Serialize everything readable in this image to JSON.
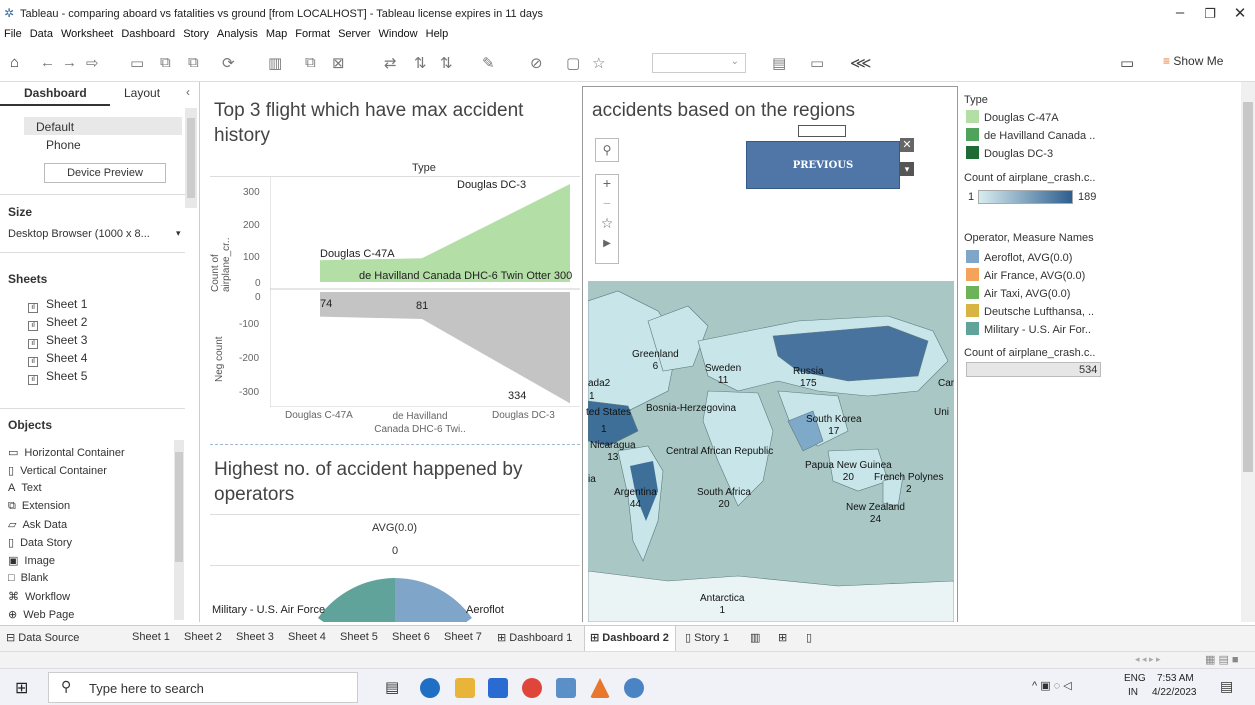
{
  "window": {
    "title": "Tableau - comparing aboard vs fatalities vs ground [from LOCALHOST] - Tableau license expires in 11 days"
  },
  "menu": [
    "File",
    "Data",
    "Worksheet",
    "Dashboard",
    "Story",
    "Analysis",
    "Map",
    "Format",
    "Server",
    "Window",
    "Help"
  ],
  "toolbar": {
    "show_me": "Show Me"
  },
  "left": {
    "tab_dashboard": "Dashboard",
    "tab_layout": "Layout",
    "device_default": "Default",
    "device_phone": "Phone",
    "device_preview": "Device Preview",
    "size_header": "Size",
    "size_value": "Desktop Browser (1000 x 8...",
    "sheets_header": "Sheets",
    "sheets": [
      "Sheet 1",
      "Sheet 2",
      "Sheet 3",
      "Sheet 4",
      "Sheet 5"
    ],
    "objects_header": "Objects",
    "objects": [
      "Horizontal Container",
      "Vertical Container",
      "Text",
      "Extension",
      "Ask Data",
      "Data Story",
      "Image",
      "Blank",
      "Workflow",
      "Web Page"
    ]
  },
  "chart1": {
    "title_line1": "Top 3 flight which have max accident",
    "title_line2": "history",
    "header": "Type",
    "ylabel_top": "Count of airplane_cr..",
    "ylabel_bottom": "Neg count",
    "top_ticks": [
      "300",
      "200",
      "100",
      "0"
    ],
    "bottom_ticks": [
      "0",
      "-100",
      "-200",
      "-300"
    ],
    "x_labels": [
      [
        "Douglas C-47A"
      ],
      [
        "de Havilland",
        "Canada DHC-6 Twi.."
      ],
      [
        "Douglas DC-3"
      ]
    ],
    "labels": {
      "c47": "Douglas C-47A",
      "dhc": "de Havilland Canada DHC-6 Twin Otter 300",
      "dc3": "Douglas DC-3",
      "v1": "74",
      "v2": "81",
      "v3": "334"
    }
  },
  "chart_data": [
    {
      "type": "area",
      "title": "Top 3 flight which have max accident history",
      "categories": [
        "Douglas C-47A",
        "de Havilland Canada DHC-6 Twin Otter 300",
        "Douglas DC-3"
      ],
      "series": [
        {
          "name": "Count of airplane_cr..",
          "values": [
            74,
            81,
            334
          ]
        },
        {
          "name": "Neg count",
          "values": [
            -74,
            -81,
            -334
          ]
        }
      ],
      "ylim_top": [
        0,
        350
      ],
      "ylim_bottom": [
        -350,
        0
      ],
      "colors": [
        "#b3dea6",
        "#c4c4c4"
      ]
    },
    {
      "type": "pie",
      "title": "Highest no. of accident happened by operators",
      "header": "AVG(0.0)",
      "value_label": "0",
      "slices": [
        {
          "label": "Military - U.S. Air Force",
          "color": "#5fa39b"
        },
        {
          "label": "Aeroflot",
          "color": "#7fa6c9"
        }
      ]
    }
  ],
  "chart2": {
    "title_line1": "Highest no. of accident happened by",
    "title_line2": "operators",
    "header": "AVG(0.0)",
    "zero": "0",
    "label_left": "Military - U.S. Air Force",
    "label_right": "Aeroflot"
  },
  "map": {
    "title": "accidents based on the regions",
    "button": "PREVIOUS",
    "labels": [
      {
        "t": "Greenland\n6"
      },
      {
        "t": "Sweden\n11"
      },
      {
        "t": "Russia\n175"
      },
      {
        "t": "ada2"
      },
      {
        "t": "1"
      },
      {
        "t": "ted States"
      },
      {
        "t": "1"
      },
      {
        "t": "Bosnia-Herzegovina"
      },
      {
        "t": "South Korea\n17"
      },
      {
        "t": "Nicaragua\n13"
      },
      {
        "t": "Central African Republic"
      },
      {
        "t": "Papua New Guinea\n20"
      },
      {
        "t": "French Polynes\n2"
      },
      {
        "t": "Argentina\n44"
      },
      {
        "t": "South Africa\n20"
      },
      {
        "t": "New Zealand\n24"
      },
      {
        "t": "Antarctica\n1"
      },
      {
        "t": "Car"
      },
      {
        "t": "Uni"
      },
      {
        "t": "ia"
      }
    ]
  },
  "legend": {
    "type_title": "Type",
    "types": [
      {
        "label": "Douglas C-47A",
        "color": "#b3dea6"
      },
      {
        "label": "de Havilland Canada ..",
        "color": "#4fa35a"
      },
      {
        "label": "Douglas DC-3",
        "color": "#1f6b35"
      }
    ],
    "count_title": "Count of airplane_crash.c..",
    "count_min": "1",
    "count_max": "189",
    "operator_title": "Operator, Measure Names",
    "operators": [
      {
        "label": "Aeroflot, AVG(0.0)",
        "color": "#7fa6c9"
      },
      {
        "label": "Air France, AVG(0.0)",
        "color": "#f4a35a"
      },
      {
        "label": "Air Taxi, AVG(0.0)",
        "color": "#6cb35a"
      },
      {
        "label": "Deutsche Lufthansa, ..",
        "color": "#d8b442"
      },
      {
        "label": "Military - U.S. Air For..",
        "color": "#5fa39b"
      }
    ],
    "count2_title": "Count of airplane_crash.c..",
    "count2_value": "534"
  },
  "tabs": [
    "Data Source",
    "Sheet 1",
    "Sheet 2",
    "Sheet 3",
    "Sheet 4",
    "Sheet 5",
    "Sheet 6",
    "Sheet 7",
    "Dashboard 1",
    "Dashboard 2",
    "Story 1"
  ],
  "taskbar": {
    "search": "Type here to search",
    "lang1": "ENG",
    "lang2": "IN",
    "time": "7:53 AM",
    "date": "4/22/2023"
  }
}
